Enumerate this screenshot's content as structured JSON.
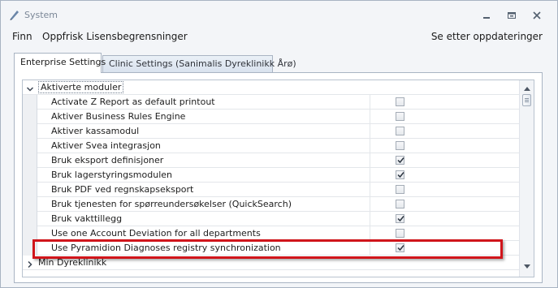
{
  "window": {
    "title": "System",
    "icon": "pencil-icon",
    "controls": [
      "minimize-icon",
      "restore-icon",
      "close-icon"
    ]
  },
  "menu": {
    "items": [
      "Finn",
      "Oppfrisk Lisensbegrensninger"
    ],
    "right_item": "Se etter oppdateringer"
  },
  "tabs": [
    {
      "label": "Enterprise Settings",
      "active": true
    },
    {
      "label": "Clinic Settings (Sanimalis Dyreklinikk Årø)",
      "active": false
    }
  ],
  "grid": {
    "categories": [
      {
        "label": "Aktiverte moduler",
        "expanded": true,
        "rows": [
          {
            "name": "Activate Z Report as default printout",
            "checked": false
          },
          {
            "name": "Aktiver Business Rules Engine",
            "checked": false
          },
          {
            "name": "Aktiver kassamodul",
            "checked": false
          },
          {
            "name": "Aktiver Svea integrasjon",
            "checked": false
          },
          {
            "name": "Bruk eksport definisjoner",
            "checked": true
          },
          {
            "name": "Bruk lagerstyringsmodulen",
            "checked": true
          },
          {
            "name": "Bruk PDF ved regnskapseksport",
            "checked": false
          },
          {
            "name": "Bruk tjenesten for spørreundersøkelser (QuickSearch)",
            "checked": false
          },
          {
            "name": "Bruk vakttillegg",
            "checked": true
          },
          {
            "name": "Use one Account Deviation for all departments",
            "checked": false
          },
          {
            "name": "Use Pyramidion Diagnoses registry synchronization",
            "checked": true
          }
        ]
      },
      {
        "label": "Min Dyreklinikk",
        "expanded": false,
        "rows": []
      }
    ]
  },
  "colors": {
    "highlight_border": "#d0151b",
    "window_bg": "#f3f5f8",
    "tab_border": "#a9b4c3"
  }
}
